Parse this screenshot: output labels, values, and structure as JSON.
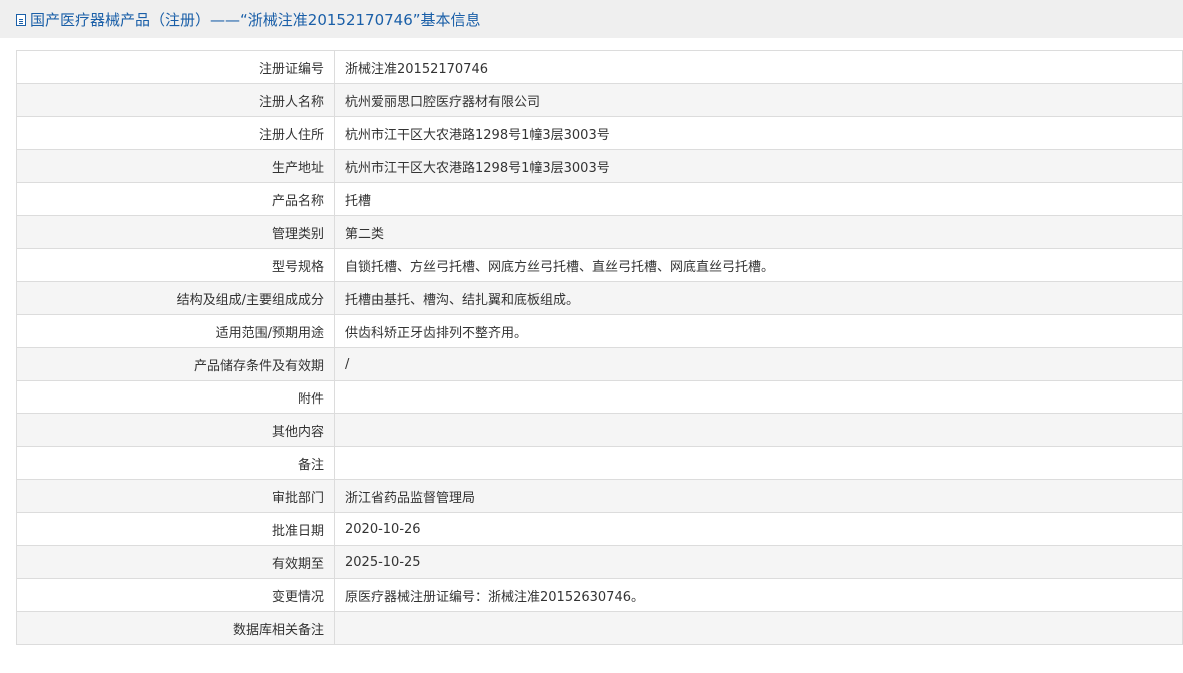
{
  "header": {
    "title": "国产医疗器械产品（注册）——“浙械注准20152170746”基本信息"
  },
  "rows": [
    {
      "label": "注册证编号",
      "value": "浙械注准20152170746"
    },
    {
      "label": "注册人名称",
      "value": "杭州爱丽思口腔医疗器材有限公司"
    },
    {
      "label": "注册人住所",
      "value": "杭州市江干区大农港路1298号1幢3层3003号"
    },
    {
      "label": "生产地址",
      "value": "杭州市江干区大农港路1298号1幢3层3003号"
    },
    {
      "label": "产品名称",
      "value": "托槽"
    },
    {
      "label": "管理类别",
      "value": "第二类"
    },
    {
      "label": "型号规格",
      "value": "自锁托槽、方丝弓托槽、网底方丝弓托槽、直丝弓托槽、网底直丝弓托槽。"
    },
    {
      "label": "结构及组成/主要组成成分",
      "value": "托槽由基托、槽沟、结扎翼和底板组成。"
    },
    {
      "label": "适用范围/预期用途",
      "value": "供齿科矫正牙齿排列不整齐用。"
    },
    {
      "label": "产品储存条件及有效期",
      "value": "/"
    },
    {
      "label": "附件",
      "value": ""
    },
    {
      "label": "其他内容",
      "value": ""
    },
    {
      "label": "备注",
      "value": ""
    },
    {
      "label": "审批部门",
      "value": "浙江省药品监督管理局"
    },
    {
      "label": "批准日期",
      "value": "2020-10-26"
    },
    {
      "label": "有效期至",
      "value": "2025-10-25"
    },
    {
      "label": "变更情况",
      "value": "原医疗器械注册证编号：浙械注准20152630746。"
    },
    {
      "label": "数据库相关备注",
      "value": ""
    }
  ]
}
